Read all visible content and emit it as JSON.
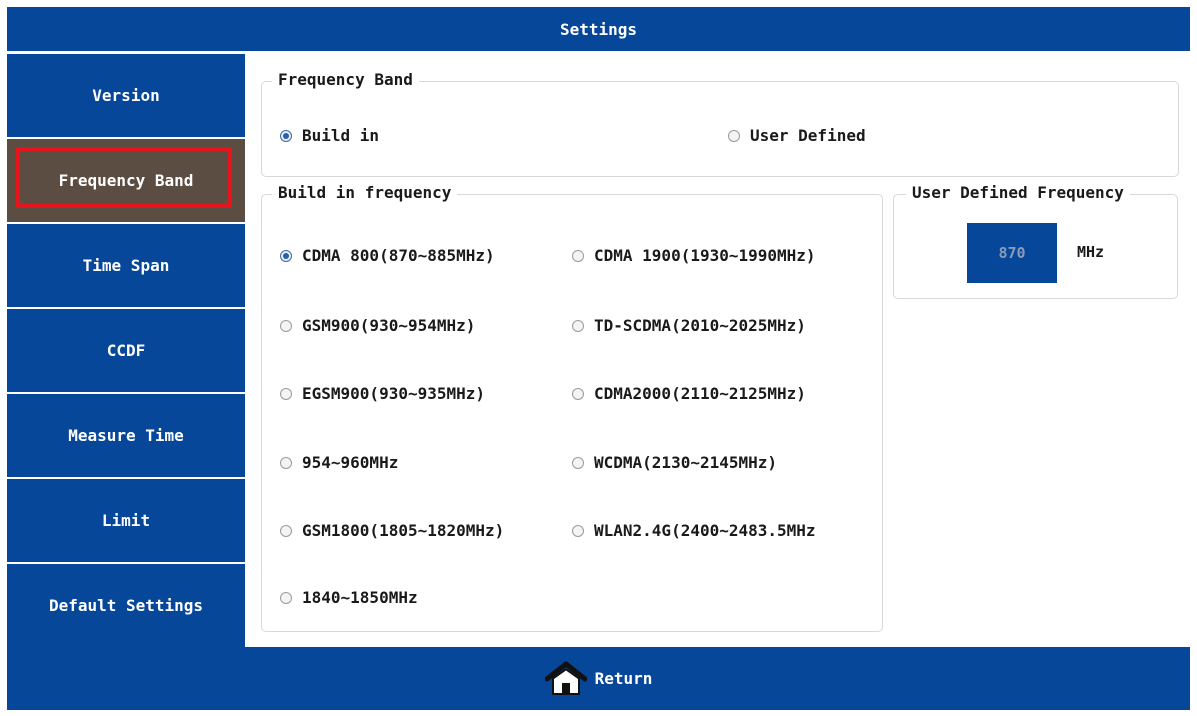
{
  "title": "Settings",
  "sidebar": {
    "items": [
      {
        "label": "Version"
      },
      {
        "label": "Frequency Band"
      },
      {
        "label": "Time Span"
      },
      {
        "label": "CCDF"
      },
      {
        "label": "Measure Time"
      },
      {
        "label": "Limit"
      },
      {
        "label": "Default Settings"
      }
    ],
    "selected": "Frequency Band"
  },
  "frequency_band": {
    "title": "Frequency Band",
    "options": [
      {
        "label": "Build in",
        "checked": true
      },
      {
        "label": "User Defined",
        "checked": false
      }
    ]
  },
  "build_in": {
    "title": "Build in frequency",
    "options": [
      {
        "label": "CDMA 800(870~885MHz)",
        "checked": true
      },
      {
        "label": "CDMA 1900(1930~1990MHz)",
        "checked": false
      },
      {
        "label": "GSM900(930~954MHz)",
        "checked": false
      },
      {
        "label": "TD-SCDMA(2010~2025MHz)",
        "checked": false
      },
      {
        "label": "EGSM900(930~935MHz)",
        "checked": false
      },
      {
        "label": "CDMA2000(2110~2125MHz)",
        "checked": false
      },
      {
        "label": "954~960MHz",
        "checked": false
      },
      {
        "label": "WCDMA(2130~2145MHz)",
        "checked": false
      },
      {
        "label": "GSM1800(1805~1820MHz)",
        "checked": false
      },
      {
        "label": "WLAN2.4G(2400~2483.5MHz",
        "checked": false
      },
      {
        "label": "1840~1850MHz",
        "checked": false
      }
    ]
  },
  "user_defined": {
    "title": "User Defined Frequency",
    "value": "870",
    "unit": "MHz"
  },
  "footer": {
    "return_label": "Return",
    "icon": "home-icon"
  },
  "colors": {
    "primary": "#06479a",
    "selected_bg": "#5c4d43",
    "selected_outline": "#e8141b"
  }
}
